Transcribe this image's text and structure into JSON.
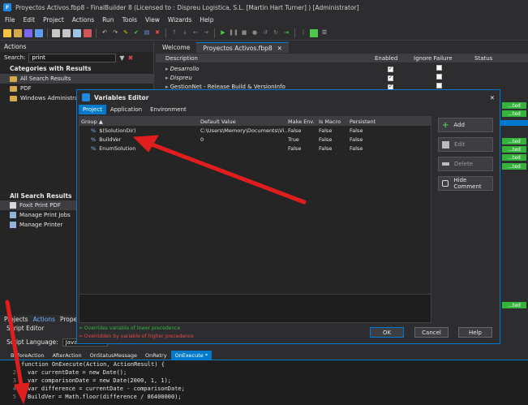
{
  "window": {
    "title": "Proyectos Activos.fbp8 - FinalBuilder 8 (Licensed to : Dispreu Logistica, S.L. [Martin Hart Turner] ) [Administrator]"
  },
  "menu": [
    "File",
    "Edit",
    "Project",
    "Actions",
    "Run",
    "Tools",
    "View",
    "Wizards",
    "Help"
  ],
  "actions_panel": {
    "title": "Actions",
    "search_label": "Search:",
    "search_value": "print",
    "categories_title": "Categories with Results",
    "categories": [
      "All Search Results",
      "PDF",
      "Windows Administrati..."
    ],
    "results_title": "All Search Results",
    "results": [
      "Foxit Print PDF",
      "Manage Print Jobs",
      "Manage Printer"
    ]
  },
  "doc_tabs": [
    "Welcome",
    "Proyectos Activos.fbp8"
  ],
  "project_grid": {
    "columns": [
      "Description",
      "Enabled",
      "Ignore Failure",
      "Status"
    ],
    "rows": [
      {
        "name": "Desarrollo",
        "enabled": true,
        "ignore": false
      },
      {
        "name": "Dispreu",
        "enabled": true,
        "ignore": false
      },
      {
        "name": "GestionNet - Release Build & VersionInfo",
        "enabled": true,
        "ignore": false
      }
    ],
    "status_badges": [
      "...ted",
      "...ted",
      "...ted",
      "...ted",
      "...ted",
      "...ted",
      "...ted"
    ]
  },
  "dialog": {
    "title": "Variables Editor",
    "tabs": [
      "Project",
      "Application",
      "Environment"
    ],
    "columns": [
      "Group",
      "Default Value",
      "Make Env.",
      "Is Macro",
      "Persistent"
    ],
    "rows": [
      {
        "name": "$(SolutionDir)",
        "default": "C:\\Users\\Memory\\Documents\\Vi...",
        "env": "False",
        "macro": "False",
        "persistent": "False"
      },
      {
        "name": "BuildVer",
        "default": "0",
        "env": "True",
        "macro": "False",
        "persistent": "False"
      },
      {
        "name": "EnumSolution",
        "default": "",
        "env": "False",
        "macro": "False",
        "persistent": "False"
      }
    ],
    "buttons": {
      "add": "Add",
      "edit": "Edit",
      "delete": "Delete",
      "hide_comment": "Hide Comment"
    },
    "legend_green": "= Overrides variable of lower precedence",
    "legend_red": "= Overridden by variable of higher precedence",
    "ok": "OK",
    "cancel": "Cancel",
    "help": "Help"
  },
  "bottom_tabs": [
    "Projects",
    "Actions",
    "Proper"
  ],
  "script_editor": {
    "title": "Script Editor",
    "language_label": "Script Language:",
    "language_value": "JavaScri",
    "event_tabs": [
      "BeforeAction",
      "AfterAction",
      "OnStatusMessage",
      "OnRetry",
      "OnExecute *"
    ],
    "code": [
      {
        "ln": "",
        "text": "function OnExecute(Action, ActionResult) {"
      },
      {
        "ln": "2",
        "text": "var currentDate = new Date();"
      },
      {
        "ln": "3",
        "text": "var comparisonDate = new Date(2000, 1, 1);"
      },
      {
        "ln": "4",
        "text": "var difference = currentDate - comparisonDate;"
      },
      {
        "ln": "5",
        "text": "BuildVer = Math.floor(difference / 86400000);"
      }
    ]
  },
  "colors": {
    "accent": "#007acc",
    "arrow": "#e01e1e",
    "status_green": "#35b43c"
  }
}
